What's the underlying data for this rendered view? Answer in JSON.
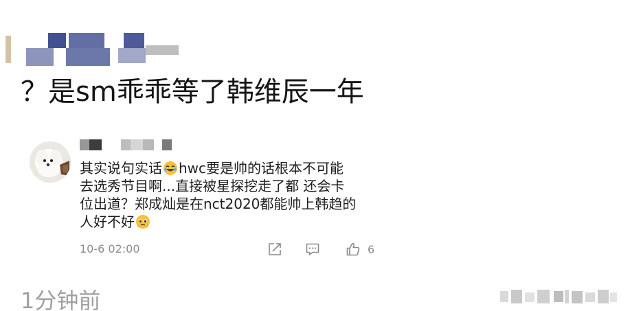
{
  "post": {
    "title": "？是sm乖乖等了韩维辰一年"
  },
  "comment": {
    "line1_a": "其实说句实话",
    "line1_b": "hwc要是帅的话根本不可能",
    "line2": "去选秀节目啊...直接被星探挖走了都 还会卡",
    "line3": "位出道？郑成灿是在nct2020都能帅上韩趋的",
    "line4": "人好不好",
    "time": "10-6 02:00",
    "like_count": "6",
    "icons": {
      "share": "share-icon",
      "reply": "comment-icon",
      "like": "thumbs-up-icon",
      "laugh": "rofl-emoji",
      "pray": "pleading-emoji"
    }
  },
  "footer": {
    "time": "1分钟前"
  },
  "colors": {
    "text": "#1e1e1e",
    "muted": "#8c8c8c",
    "footer": "#a0a0a0",
    "censor": "#2f3e86"
  }
}
